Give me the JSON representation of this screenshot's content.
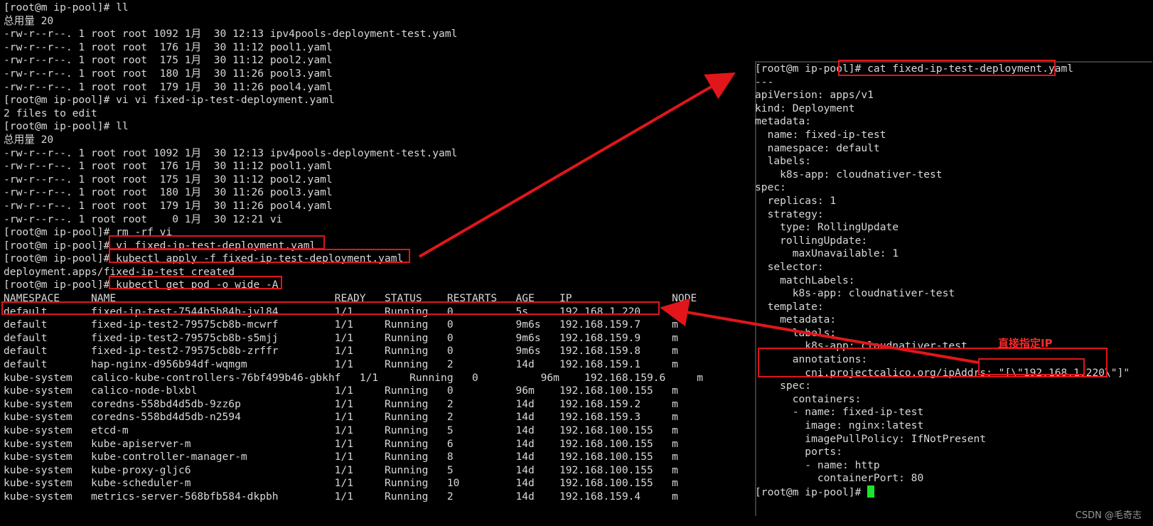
{
  "left_terminal": {
    "lines": [
      "[root@m ip-pool]# ll",
      "总用量 20",
      "-rw-r--r--. 1 root root 1092 1月  30 12:13 ipv4pools-deployment-test.yaml",
      "-rw-r--r--. 1 root root  176 1月  30 11:12 pool1.yaml",
      "-rw-r--r--. 1 root root  175 1月  30 11:12 pool2.yaml",
      "-rw-r--r--. 1 root root  180 1月  30 11:26 pool3.yaml",
      "-rw-r--r--. 1 root root  179 1月  30 11:26 pool4.yaml",
      "[root@m ip-pool]# vi vi fixed-ip-test-deployment.yaml",
      "2 files to edit",
      "[root@m ip-pool]# ll",
      "总用量 20",
      "-rw-r--r--. 1 root root 1092 1月  30 12:13 ipv4pools-deployment-test.yaml",
      "-rw-r--r--. 1 root root  176 1月  30 11:12 pool1.yaml",
      "-rw-r--r--. 1 root root  175 1月  30 11:12 pool2.yaml",
      "-rw-r--r--. 1 root root  180 1月  30 11:26 pool3.yaml",
      "-rw-r--r--. 1 root root  179 1月  30 11:26 pool4.yaml",
      "-rw-r--r--. 1 root root    0 1月  30 12:21 vi",
      "[root@m ip-pool]# rm -rf vi",
      "[root@m ip-pool]# vi fixed-ip-test-deployment.yaml",
      "[root@m ip-pool]# kubectl apply -f fixed-ip-test-deployment.yaml",
      "deployment.apps/fixed-ip-test created",
      "[root@m ip-pool]# kubectl get pod -o wide -A",
      "NAMESPACE     NAME                                   READY   STATUS    RESTARTS   AGE    IP                NODE",
      "default       fixed-ip-test-7544b5b84b-jvl84         1/1     Running   0          5s     192.168.1.220     m",
      "default       fixed-ip-test2-79575cb8b-mcwrf         1/1     Running   0          9m6s   192.168.159.7     m",
      "default       fixed-ip-test2-79575cb8b-s5mjj         1/1     Running   0          9m6s   192.168.159.9     m",
      "default       fixed-ip-test2-79575cb8b-zrffr         1/1     Running   0          9m6s   192.168.159.8     m",
      "default       hap-nginx-d956b94df-wqmgm              1/1     Running   2          14d    192.168.159.1     m",
      "kube-system   calico-kube-controllers-76bf499b46-gbkhf   1/1     Running   0          96m    192.168.159.6     m",
      "kube-system   calico-node-blxbl                      1/1     Running   0          96m    192.168.100.155   m",
      "kube-system   coredns-558bd4d5db-9zz6p               1/1     Running   2          14d    192.168.159.2     m",
      "kube-system   coredns-558bd4d5db-n2594               1/1     Running   2          14d    192.168.159.3     m",
      "kube-system   etcd-m                                 1/1     Running   5          14d    192.168.100.155   m",
      "kube-system   kube-apiserver-m                       1/1     Running   6          14d    192.168.100.155   m",
      "kube-system   kube-controller-manager-m              1/1     Running   8          14d    192.168.100.155   m",
      "kube-system   kube-proxy-gljc6                       1/1     Running   5          14d    192.168.100.155   m",
      "kube-system   kube-scheduler-m                       1/1     Running   10         14d    192.168.100.155   m",
      "kube-system   metrics-server-568bfb584-dkpbh         1/1     Running   2          14d    192.168.159.4     m"
    ]
  },
  "right_terminal": {
    "lines": [
      "[root@m ip-pool]# cat fixed-ip-test-deployment.yaml",
      "---",
      "apiVersion: apps/v1",
      "kind: Deployment",
      "metadata:",
      "  name: fixed-ip-test",
      "  namespace: default",
      "  labels:",
      "    k8s-app: cloudnativer-test",
      "spec:",
      "  replicas: 1",
      "  strategy:",
      "    type: RollingUpdate",
      "    rollingUpdate:",
      "      maxUnavailable: 1",
      "  selector:",
      "    matchLabels:",
      "      k8s-app: cloudnativer-test",
      "  template:",
      "    metadata:",
      "      labels:",
      "        k8s-app: cloudnativer-test",
      "      annotations:",
      "        cni.projectcalico.org/ipAddrs: \"[\\\"192.168.1.220\\\"]\"",
      "    spec:",
      "      containers:",
      "      - name: fixed-ip-test",
      "        image: nginx:latest",
      "        imagePullPolicy: IfNotPresent",
      "        ports:",
      "        - name: http",
      "          containerPort: 80"
    ],
    "prompt": "[root@m ip-pool]# "
  },
  "annotation_note": "直接指定IP",
  "watermark": "CSDN @毛奇志",
  "colors": {
    "highlight_box": "#e0161a",
    "arrow": "#e0161a",
    "cursor": "#19e62b",
    "note": "#ff2a2a"
  }
}
